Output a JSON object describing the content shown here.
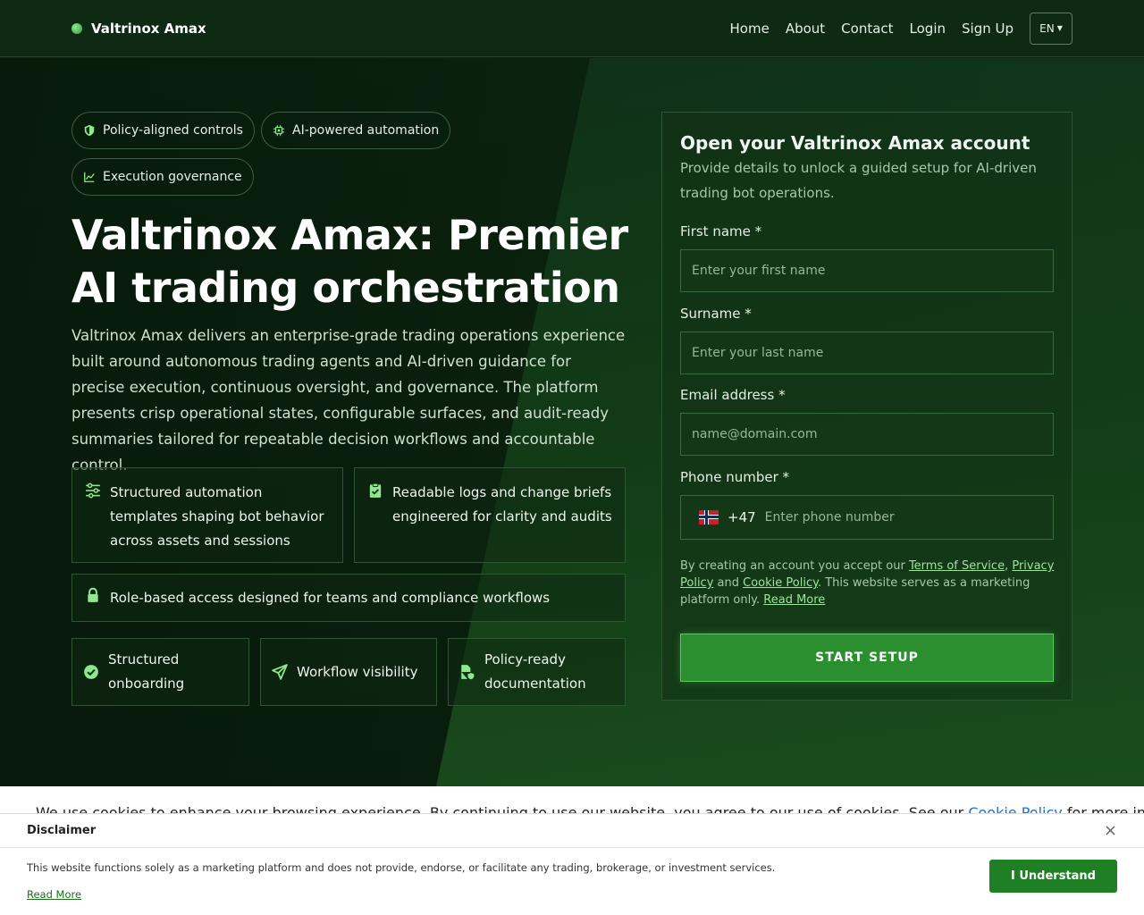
{
  "header": {
    "brand": "Valtrinox Amax",
    "nav": [
      "Home",
      "About",
      "Contact",
      "Login",
      "Sign Up"
    ],
    "lang": "EN"
  },
  "hero": {
    "pills": [
      "Policy-aligned controls",
      "AI-powered automation",
      "Execution governance"
    ],
    "title": "Valtrinox Amax: Premier AI trading orchestration",
    "description": "Valtrinox Amax delivers an enterprise-grade trading operations experience built around autonomous trading agents and AI-driven guidance for precise execution, continuous oversight, and governance. The platform presents crisp operational states, configurable surfaces, and audit-ready summaries tailored for repeatable decision workflows and accountable control.",
    "features": [
      "Structured automation templates shaping bot behavior across assets and sessions",
      "Readable logs and change briefs engineered for clarity and audits",
      "Role-based access designed for teams and compliance workflows"
    ],
    "mini_features": [
      "Structured onboarding",
      "Workflow visibility",
      "Policy-ready documentation"
    ]
  },
  "form": {
    "title": "Open your Valtrinox Amax account",
    "subtitle": "Provide details to unlock a guided setup for AI-driven trading bot operations.",
    "first_name_label": "First name *",
    "first_name_placeholder": "Enter your first name",
    "surname_label": "Surname *",
    "surname_placeholder": "Enter your last name",
    "email_label": "Email address *",
    "email_placeholder": "name@domain.com",
    "phone_label": "Phone number *",
    "phone_code": "+47",
    "phone_placeholder": "Enter phone number",
    "legal_prefix": "By creating an account you accept our ",
    "terms": "Terms of Service",
    "comma": ", ",
    "privacy": "Privacy Policy",
    "and": " and ",
    "cookie": "Cookie Policy",
    "legal_suffix": ". This website serves as a marketing platform only. ",
    "read_more": "Read More",
    "submit": "START SETUP"
  },
  "cookie_bar": {
    "text": "We use cookies to enhance your browsing experience. By continuing to use our website, you agree to our use of cookies. See our ",
    "link": "Cookie Policy",
    "suffix": " for more informa"
  },
  "disclaimer": {
    "title": "Disclaimer",
    "close": "×",
    "text": "This website functions solely as a marketing platform and does not provide, endorse, or facilitate any trading, brokerage, or investment services.",
    "read_more": "Read More",
    "button": "I Understand"
  },
  "colors": {
    "accent": "#2b8f2f",
    "accent_light": "#8ee88e",
    "background": "#0b2410",
    "link": "#9fe39f"
  },
  "icons": {
    "pill_icons": [
      "shield-icon",
      "chip-icon",
      "chart-line-icon"
    ],
    "feature_icons": [
      "sliders-icon",
      "clipboard-check-icon",
      "lock-icon"
    ],
    "mini_icons": [
      "check-circle-icon",
      "send-icon",
      "file-shield-icon"
    ]
  }
}
